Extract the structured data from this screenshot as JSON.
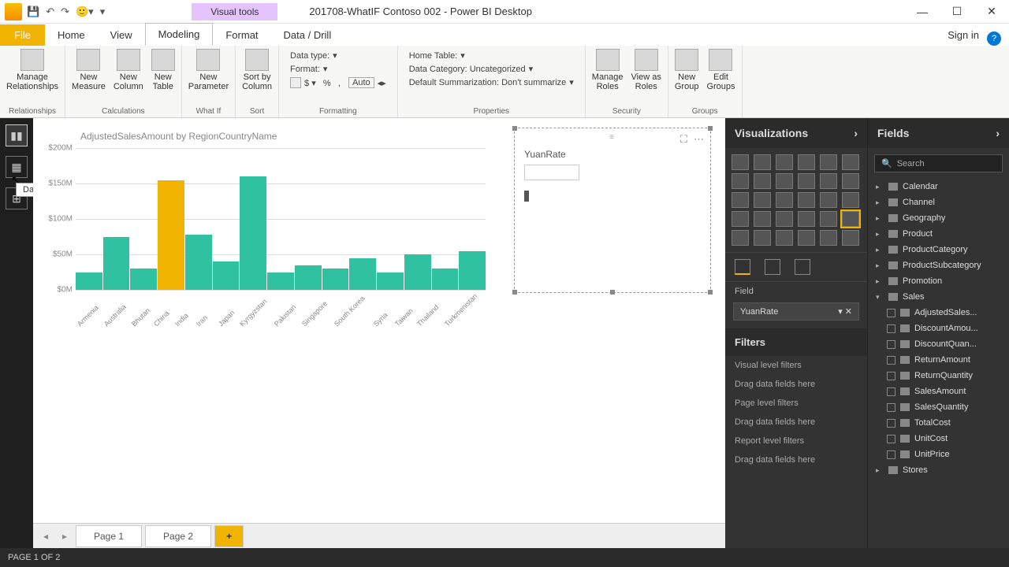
{
  "app": {
    "contextual_tab": "Visual tools",
    "doc_title": "201708-WhatIF Contoso 002 - Power BI Desktop",
    "signin": "Sign in"
  },
  "menu": {
    "file": "File",
    "tabs": [
      "Home",
      "View",
      "Modeling",
      "Format",
      "Data / Drill"
    ]
  },
  "ribbon": {
    "groups": {
      "relationships": {
        "label": "Relationships",
        "btn": "Manage\nRelationships"
      },
      "calculations": {
        "label": "Calculations",
        "btns": [
          "New\nMeasure",
          "New\nColumn",
          "New\nTable"
        ]
      },
      "whatif": {
        "label": "What If",
        "btn": "New\nParameter"
      },
      "sort": {
        "label": "Sort",
        "btn": "Sort by\nColumn"
      },
      "formatting": {
        "label": "Formatting",
        "rows": [
          "Data type:",
          "Format:"
        ],
        "auto": "Auto"
      },
      "properties": {
        "label": "Properties",
        "rows": [
          "Home Table:",
          "Data Category: Uncategorized",
          "Default Summarization: Don't summarize"
        ]
      },
      "security": {
        "label": "Security",
        "btns": [
          "Manage\nRoles",
          "View as\nRoles"
        ]
      },
      "groups": {
        "label": "Groups",
        "btns": [
          "New\nGroup",
          "Edit\nGroups"
        ]
      }
    }
  },
  "viewbar": {
    "tooltip": "Data"
  },
  "chart_data": {
    "type": "bar",
    "title": "AdjustedSalesAmount by RegionCountryName",
    "ylabel": "",
    "xlabel": "",
    "ylim": [
      0,
      200
    ],
    "yticks": [
      "$200M",
      "$150M",
      "$100M",
      "$50M",
      "$0M"
    ],
    "categories": [
      "Armenia",
      "Australia",
      "Bhutan",
      "China",
      "India",
      "Iran",
      "Japan",
      "Kyrgyzstan",
      "Pakistan",
      "Singapore",
      "South Korea",
      "Syria",
      "Taiwan",
      "Thailand",
      "Turkmenistan"
    ],
    "values": [
      25,
      75,
      30,
      155,
      78,
      40,
      160,
      25,
      35,
      30,
      45,
      25,
      50,
      30,
      55
    ],
    "highlight": "China"
  },
  "slicer": {
    "title": "YuanRate"
  },
  "pages": {
    "tabs": [
      "Page 1",
      "Page 2"
    ],
    "add": "+"
  },
  "viz": {
    "header": "Visualizations",
    "field_label": "Field",
    "field_value": "YuanRate",
    "filters_header": "Filters",
    "filters": [
      "Visual level filters",
      "Drag data fields here",
      "Page level filters",
      "Drag data fields here",
      "Report level filters",
      "Drag data fields here"
    ]
  },
  "fields": {
    "header": "Fields",
    "search_placeholder": "Search",
    "tables": [
      "Calendar",
      "Channel",
      "Geography",
      "Product",
      "ProductCategory",
      "ProductSubcategory",
      "Promotion",
      "Sales",
      "Stores"
    ],
    "sales_fields": [
      "AdjustedSales...",
      "DiscountAmou...",
      "DiscountQuan...",
      "ReturnAmount",
      "ReturnQuantity",
      "SalesAmount",
      "SalesQuantity",
      "TotalCost",
      "UnitCost",
      "UnitPrice"
    ]
  },
  "status": "PAGE 1 OF 2"
}
